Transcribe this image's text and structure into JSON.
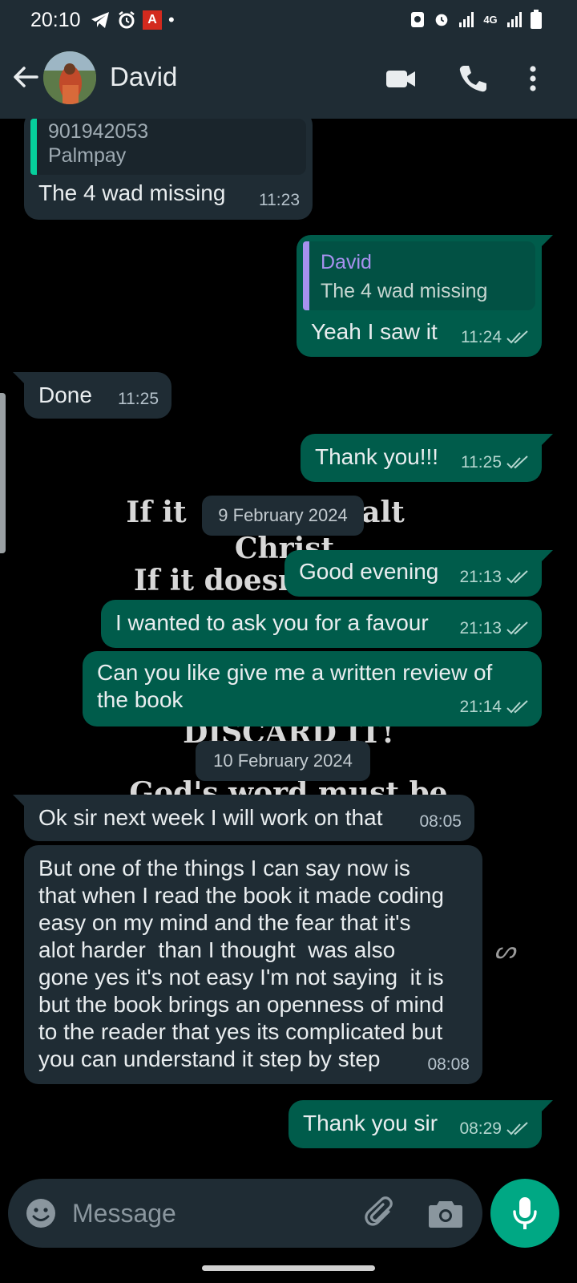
{
  "status_bar": {
    "time": "20:10",
    "network": "4G",
    "app_badge": "A",
    "dot": "•"
  },
  "header": {
    "contact_name": "David"
  },
  "wallpaper": {
    "line1_left": "If it",
    "line1_right": "alt",
    "line2": "Christ",
    "line3": "If it doesn",
    "line5": "DISCARD IT!",
    "line6": "God's word must be"
  },
  "messages": [
    {
      "id": "m1",
      "direction": "in",
      "quote_number": "901942053",
      "quote_sub": "Palmpay",
      "text": "The 4 wad missing",
      "time": "11:23"
    },
    {
      "id": "m2",
      "direction": "out",
      "quote_name": "David",
      "quote_text": "The 4 wad missing",
      "text": "Yeah I saw it",
      "time": "11:24",
      "status": "read"
    },
    {
      "id": "m3",
      "direction": "in",
      "text": "Done",
      "time": "11:25"
    },
    {
      "id": "m4",
      "direction": "out",
      "text": "Thank you!!!",
      "time": "11:25",
      "status": "read"
    },
    {
      "id": "m5",
      "direction": "out",
      "text": "Good evening",
      "time": "21:13",
      "status": "read"
    },
    {
      "id": "m6",
      "direction": "out",
      "text": "I wanted to ask you for a favour",
      "time": "21:13",
      "status": "read"
    },
    {
      "id": "m7",
      "direction": "out",
      "text_lines": [
        "Can you like give me a written review of",
        "the book"
      ],
      "time": "21:14",
      "status": "read"
    },
    {
      "id": "m8",
      "direction": "in",
      "text": "Ok sir next week I will work on that",
      "time": "08:05"
    },
    {
      "id": "m9",
      "direction": "in",
      "text_lines": [
        "But one of the things I can say now is",
        "that when I read the book it made coding",
        "easy on my mind and the fear that it's",
        "alot harder  than I thought  was also",
        "gone yes it's not easy I'm not saying  it is",
        "but the book brings an openness of mind",
        "to the reader that yes its complicated but",
        "you can understand it step by step"
      ],
      "time": "08:08"
    },
    {
      "id": "m10",
      "direction": "out",
      "text": "Thank you sir",
      "time": "08:29",
      "status": "read"
    }
  ],
  "date_separators": [
    "9 February 2024",
    "10 February 2024"
  ],
  "composer": {
    "placeholder": "Message"
  },
  "colors": {
    "header_bg": "#1f2c34",
    "incoming_bubble": "#1f2c34",
    "outgoing_bubble": "#005c4b",
    "accent_green": "#00a884",
    "quote_name": "#a791ef"
  },
  "icons": [
    "back-arrow-icon",
    "video-call-icon",
    "voice-call-icon",
    "more-options-icon",
    "emoji-icon",
    "attach-icon",
    "camera-icon",
    "mic-icon",
    "double-check-icon"
  ]
}
